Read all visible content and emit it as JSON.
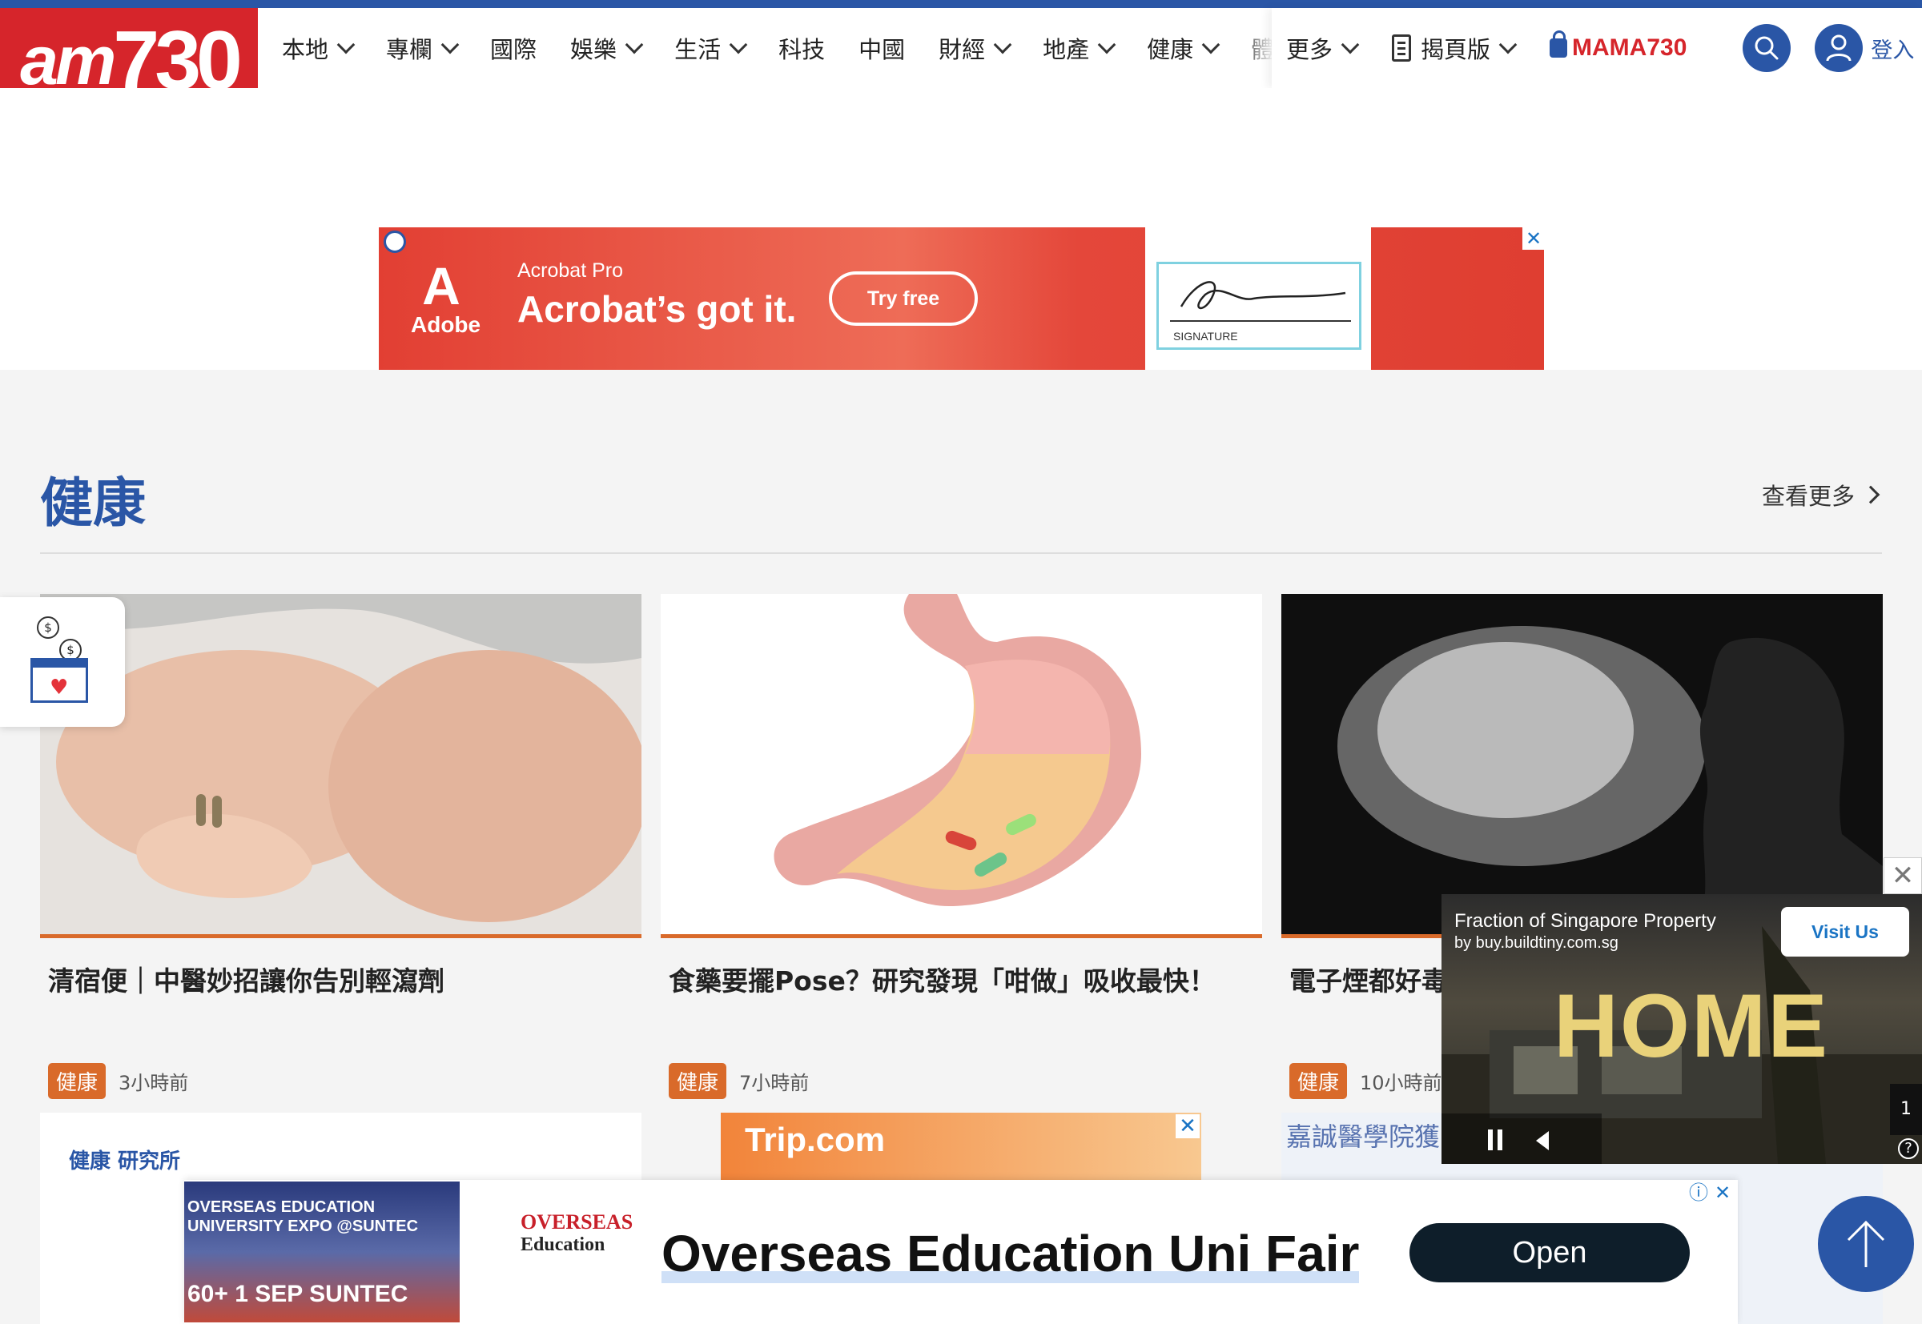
{
  "brand": {
    "logo_am": "am",
    "logo_num": "730"
  },
  "nav": {
    "items": [
      {
        "label": "本地",
        "dropdown": true
      },
      {
        "label": "專欄",
        "dropdown": true
      },
      {
        "label": "國際",
        "dropdown": false
      },
      {
        "label": "娛樂",
        "dropdown": true
      },
      {
        "label": "生活",
        "dropdown": true
      },
      {
        "label": "科技",
        "dropdown": false
      },
      {
        "label": "中國",
        "dropdown": false
      },
      {
        "label": "財經",
        "dropdown": true
      },
      {
        "label": "地產",
        "dropdown": true
      },
      {
        "label": "健康",
        "dropdown": true
      },
      {
        "label": "體",
        "dropdown": false
      }
    ],
    "more_label": "更多",
    "flipbook_label": "揭頁版",
    "mama_label": "MAMA730",
    "login_label": "登入"
  },
  "top_ad": {
    "brand": "Adobe",
    "product": "Acrobat Pro",
    "headline": "Acrobat’s got it.",
    "cta": "Try free",
    "signature_label": "SIGNATURE",
    "close": "✕"
  },
  "section": {
    "title": "健康",
    "more_label": "查看更多"
  },
  "articles": [
    {
      "title": "清宿便｜中醫妙招讓你告別輕瀉劑",
      "tag": "健康",
      "time": "3小時前"
    },
    {
      "title": "食藥要擺Pose？研究發現「咁做」吸收最快！",
      "tag": "健康",
      "time": "7小時前"
    },
    {
      "title": "電子煙都好毒 變異",
      "tag": "健康",
      "time": "10小時前"
    }
  ],
  "row2": {
    "lab_label": "健康 研究所",
    "trip_label": "Trip.com",
    "hospital_text": "嘉誠醫學院獲 磁化技術"
  },
  "video_ad": {
    "title": "Fraction of Singapore Property",
    "by": "by buy.buildtiny.com.sg",
    "cta": "Visit Us",
    "overlay": "HOME",
    "counter": "1",
    "help": "?",
    "close": "✕"
  },
  "bottom_ad": {
    "image_text": "OVERSEAS EDUCATION UNIVERSITY EXPO @SUNTEC",
    "image_badge": "60+  1 SEP SUNTEC",
    "logo_line1": "OVERSEAS",
    "logo_line2": "Education",
    "title": "Overseas Education Uni Fair",
    "cta": "Open",
    "info": "ⓘ",
    "close": "✕"
  },
  "colors": {
    "brand_red": "#d6252b",
    "brand_blue": "#2a56a6",
    "tag_orange": "#d96a2a"
  }
}
